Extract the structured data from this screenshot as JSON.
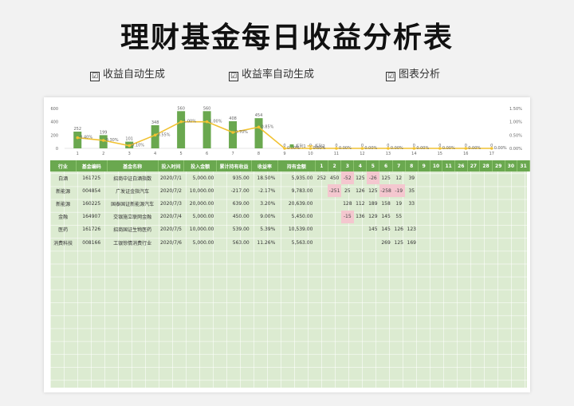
{
  "title": "理财基金每日收益分析表",
  "features": [
    {
      "check": "☑",
      "label": "收益自动生成"
    },
    {
      "check": "☑",
      "label": "收益率自动生成"
    },
    {
      "check": "☑",
      "label": "图表分析"
    }
  ],
  "chart_data": {
    "type": "bar",
    "x": [
      1,
      2,
      3,
      4,
      5,
      6,
      7,
      8,
      9,
      10,
      11,
      12,
      13,
      14,
      15,
      16,
      17
    ],
    "series": [
      {
        "name": "系列1",
        "values": [
          252,
          199,
          101,
          348,
          560,
          560,
          408,
          454,
          0,
          0,
          0,
          0,
          0,
          0,
          0,
          0,
          0
        ]
      },
      {
        "name": "系列2",
        "values": [
          0.4,
          0.3,
          0.1,
          0.5,
          1.0,
          1.0,
          0.6,
          0.8,
          0,
          0,
          0,
          0,
          0,
          0,
          0,
          0,
          0
        ]
      }
    ],
    "bar_labels": [
      "252",
      "199",
      "101",
      "348",
      "560",
      "560",
      "408",
      "454",
      "0",
      "0",
      "0",
      "0",
      "0",
      "0",
      "0",
      "0",
      "0"
    ],
    "line_labels": [
      "0.40%",
      "0.30%",
      "0.10%",
      "0.55%",
      "1.00%",
      "1.00%",
      "0.70%",
      "0.85%",
      "0.00%",
      "0.00%",
      "0.00%",
      "0.00%",
      "0.00%",
      "0.00%",
      "0.00%",
      "0.00%",
      "0.00%"
    ],
    "y_left_ticks": [
      "600",
      "400",
      "200",
      "0"
    ],
    "y_right_ticks": [
      "1.50%",
      "1.00%",
      "0.50%",
      "0.00%"
    ],
    "ylim": [
      0,
      600
    ],
    "y2lim": [
      0,
      1.5
    ]
  },
  "table": {
    "headers": [
      "行业",
      "基金编码",
      "基金名称",
      "投入时间",
      "投入金额",
      "累计持有收益",
      "收益率",
      "持有金额",
      "1",
      "2",
      "3",
      "4",
      "5",
      "6",
      "7",
      "8",
      "9",
      "10",
      "11",
      "26",
      "27",
      "28",
      "29",
      "30",
      "31"
    ],
    "rows": [
      [
        "白酒",
        "161725",
        "招商中证白酒指数",
        "2020/7/1",
        "5,000.00",
        "935.00",
        "18.50%",
        "5,935.00",
        "252",
        "450",
        "-52",
        "125",
        "-26",
        "125",
        "12",
        "39",
        "",
        "",
        "",
        "",
        "",
        "",
        "",
        "",
        ""
      ],
      [
        "新能源",
        "004854",
        "广发证金指汽车",
        "2020/7/2",
        "10,000.00",
        "-217.00",
        "-2.17%",
        "9,783.00",
        "",
        "-251",
        "25",
        "126",
        "125",
        "-258",
        "-19",
        "35",
        "",
        "",
        "",
        "",
        "",
        "",
        "",
        "",
        ""
      ],
      [
        "新能源",
        "160225",
        "国泰国证新能源汽车",
        "2020/7/3",
        "20,000.00",
        "639.00",
        "3.20%",
        "20,639.00",
        "",
        "",
        "128",
        "112",
        "189",
        "158",
        "19",
        "33",
        "",
        "",
        "",
        "",
        "",
        "",
        "",
        "",
        ""
      ],
      [
        "金融",
        "164907",
        "交银施立联网金融",
        "2020/7/4",
        "5,000.00",
        "450.00",
        "9.00%",
        "5,450.00",
        "",
        "",
        "-15",
        "136",
        "129",
        "145",
        "55",
        "",
        "",
        "",
        "",
        "",
        "",
        "",
        "",
        "",
        ""
      ],
      [
        "医药",
        "161726",
        "招商国证生物医药",
        "2020/7/5",
        "10,000.00",
        "539.00",
        "5.39%",
        "10,539.00",
        "",
        "",
        "",
        "",
        "145",
        "145",
        "126",
        "123",
        "",
        "",
        "",
        "",
        "",
        "",
        "",
        "",
        ""
      ],
      [
        "消费科技",
        "008166",
        "工银惊情消费行业",
        "2020/7/6",
        "5,000.00",
        "563.00",
        "11.26%",
        "5,563.00",
        "",
        "",
        "",
        "",
        "",
        "269",
        "125",
        "169",
        "",
        "",
        "",
        "",
        "",
        "",
        "",
        "",
        ""
      ]
    ]
  }
}
